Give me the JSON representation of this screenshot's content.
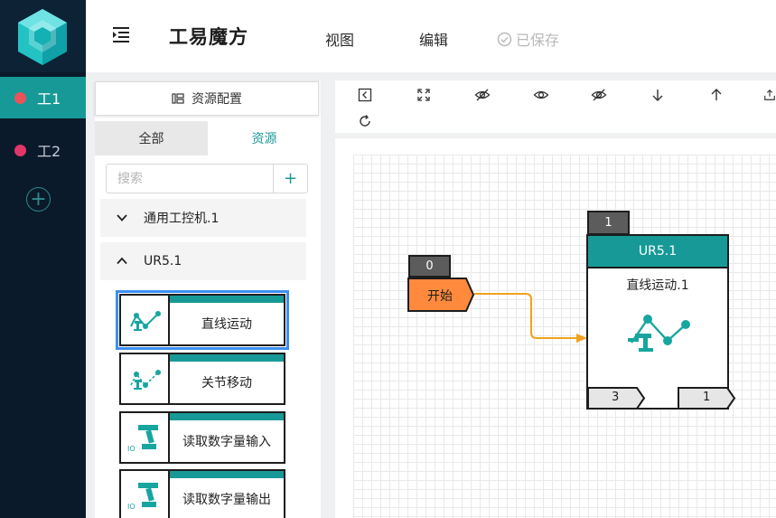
{
  "app": {
    "title": "工易魔方"
  },
  "header": {
    "menu": [
      {
        "label": "视图"
      },
      {
        "label": "编辑"
      }
    ],
    "saved_status": "已保存"
  },
  "rail": {
    "items": [
      {
        "label": "工1",
        "dot_color": "#e9535a",
        "active": true
      },
      {
        "label": "工2",
        "dot_color": "#e2366a",
        "active": false
      }
    ],
    "add_icon": "plus-circle-icon"
  },
  "panel": {
    "title": "资源配置",
    "tabs": [
      {
        "label": "全部"
      },
      {
        "label": "资源"
      }
    ],
    "search": {
      "placeholder": "搜索",
      "value": ""
    },
    "add_label": "+",
    "groups": [
      {
        "label": "通用工控机.1",
        "expanded": false
      },
      {
        "label": "UR5.1",
        "expanded": true
      }
    ],
    "cards": [
      {
        "label": "直线运动",
        "icon": "robot-arm-linear-icon"
      },
      {
        "label": "关节移动",
        "icon": "robot-arm-joint-icon"
      },
      {
        "label": "读取数字量输入",
        "icon": "io-robot-icon"
      },
      {
        "label": "读取数字量输出",
        "icon": "io-robot-icon"
      }
    ]
  },
  "toolbar": {
    "icons": [
      "collapse-left-icon",
      "fit-screen-icon",
      "eye-off-icon",
      "eye-icon",
      "eye-off-icon",
      "arrow-down-icon",
      "arrow-up-icon",
      "export-icon",
      "refresh-icon"
    ]
  },
  "canvas": {
    "start_node": {
      "index": "0",
      "label": "开始",
      "color": "#ff8a3d"
    },
    "node": {
      "index": "1",
      "header": "UR5.1",
      "label": "直线运动.1",
      "in_port": "3",
      "out_port": "1"
    },
    "edge_color": "#f0a21e"
  },
  "colors": {
    "accent": "#179a97",
    "rail": "#0a1a2b",
    "selection": "#3b8ff0"
  }
}
